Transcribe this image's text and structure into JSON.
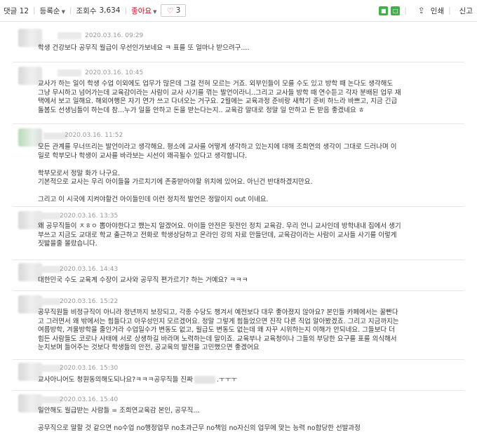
{
  "toolbar": {
    "comment_label": "댓글 12",
    "sort_label": "등록순",
    "views_label": "조회수",
    "views_value": "3,634",
    "like_label": "좋아요",
    "like_count": "3",
    "print_label": "인쇄",
    "report_label": "신고"
  },
  "comments": [
    {
      "date": "2020.03.16. 09:29",
      "lines": [
        "학생 건강보다 공무직 월급이 우선인가보네요 ㅋ 표를 또 얼마나 받으려구...."
      ]
    },
    {
      "date": "2020.03.16. 10:45",
      "lines": [
        "교사가 하는 일이 학생 수업 이외에도 업무가 많은데 그걸 전혀 모르는 거죠. 외부인들이 모를 수도 있고 방학 때 논다도 생각해도",
        "그냥 무시하고 넘어가는데 교육감이라는 사람이 교사 사기를 꺾는 발언이라니..그리고 교사들 방학 때 연수듣고 각자 분배된 업무 재",
        "택에서 보고 일해요. 해외여행은 자기 연가 쓰고 다녀오는 거구요. 2월에는 교육과정 준비랑 새학기 준비 하느라 바쁘고, 지금 긴급",
        "돌봄도 선생님들이 하는데 참...누가 일을 안하고 돈을 받는다는지.. 교육감 말대로 정말 일 안하고 돈 받음 좋겠네요 ㅎ"
      ]
    },
    {
      "date": "2020.03.16. 11:52",
      "lines": [
        "모든 관계를 무너뜨리는 발언이라고 생각해요. 평소에 교사를 어떻게 생각하고 있는지에 대해 조희연의 생각이 그대로 드러나며 이",
        "일로 학부모나 학생이 교사를 바라보는 시선이 왜곡될수 있다고 생각합니다.",
        "",
        "학부모로서 정말 화가 나구요.",
        "기본적으로 교사는 우리 아이들을 가르치기에 존중받아야할 위치에 있어요. 아닌건 반대하겠지만요.",
        "",
        "그리고 이 시국에 지켜야할건 아이들인데 이런 정치적 발언은 정말이지 out 이네요."
      ]
    },
    {
      "date": "2020.03.16. 13:35",
      "lines": [
        "왜 공무직들이 ㅈㅎㅇ 뽑아야한다고 했는지 알겠어요. 아이들 안전은 뒷전인 정치 교육감. 우리 언니 교사인데 방학내내 집에서 생기",
        "부쓰고 지금도 교대로 학교 출근하고 전화로 학생상담하고 온라인 강의 자료 만들던데, 교육감이라는 사람이 교사들 사기를 이렇게",
        "짓밟을줄 몰랐습니다."
      ]
    },
    {
      "date": "2020.03.16. 14:43",
      "lines": [
        "대한민국 수도 교육계 수장이 교사와 공무직 편가르기? 하는 거예요? ㅋㅋㅋ"
      ]
    },
    {
      "date": "2020.03.16. 15:22",
      "lines": [
        "공무직원들 비정규직이 아니라 정년까지 보장되고, 각종 수당도 챙겨서 예전보다 대우 좋아졌지 않아요? 본인들 카페에서는 꿀빤다",
        "고 그러면서 왜 밖에서는 힘들다고 아우성인지 모르겠어요. 정말 그렇게 힘들었으면 진작 다른 직업 알아봤겠죠. 그리고 지금까지는",
        "여름방학, 겨울방학을 줄인거라 수업일수가 변동도 없고, 월급도 변동도 없는데 왜 자꾸 시위하는지 이해가 안되네요. 그들보다 더",
        "힘든 사람들도 코로나 사태에 서로 상생하길 바라며 노력하는데 말이죠. 교육부나 교육청이나 그들의 부당한 요구를 표를 의식해서",
        "눈치보며 들어주는 것보다 학생들의 안전, 공교육의 발전을 고민했으면 좋겠어요"
      ]
    },
    {
      "date": "2020.03.16. 15:30",
      "lines": [
        "교사아니어도 청원동의해도되나요?ㅋㅋㅋ공무직들 진짜",
        ".ㅜㅜㅜ"
      ]
    },
    {
      "date": "2020.03.16. 15:40",
      "lines": [
        "일안해도 월급받는 사람들 = 조희연교육감 본인, 공무직...",
        "",
        "공무직으로 말할 것 같으면 no수업 no행정업무 no초과근무 no책임 no자신의 업무에 맞는 능력 no합당한 선발과정"
      ]
    }
  ]
}
